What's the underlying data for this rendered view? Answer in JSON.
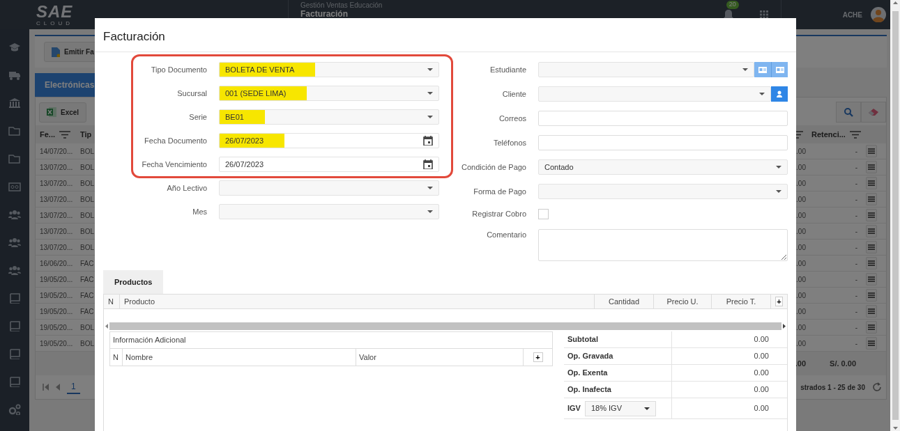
{
  "app_header": {
    "logo": "SAE",
    "logo_tagline": "CLOUD",
    "module": "Gestión Ventas Educación",
    "page": "Facturación",
    "notification_count": "20",
    "user": "ACHE"
  },
  "background": {
    "toolbar_button": "Emitir Fa",
    "tabs": [
      {
        "label": "Electrónicas",
        "selected": true
      }
    ],
    "export_button": "Excel",
    "columns_left": [
      "Fe...",
      "Tip"
    ],
    "columns_right": [
      "Retenci..."
    ],
    "rows": [
      {
        "date": "14/07/20...",
        "type": "BOL",
        "amount": ".00",
        "retention": "-"
      },
      {
        "date": "13/07/20...",
        "type": "BOL",
        "amount": ".00",
        "retention": "-"
      },
      {
        "date": "13/07/20...",
        "type": "BOL",
        "amount": ".00",
        "retention": "-"
      },
      {
        "date": "13/07/20...",
        "type": "BOL",
        "amount": ".00",
        "retention": "-"
      },
      {
        "date": "13/07/20...",
        "type": "BOL",
        "amount": ".00",
        "retention": "-"
      },
      {
        "date": "13/07/20...",
        "type": "BOL",
        "amount": ".00",
        "retention": "-"
      },
      {
        "date": "13/07/20...",
        "type": "BOL",
        "amount": ".00",
        "retention": "-"
      },
      {
        "date": "16/06/20...",
        "type": "FAC",
        "amount": ".00",
        "retention": "-"
      },
      {
        "date": "19/05/20...",
        "type": "FAC",
        "amount": ".00",
        "retention": "-"
      },
      {
        "date": "19/05/20...",
        "type": "FAC",
        "amount": ".00",
        "retention": "-"
      },
      {
        "date": "19/05/20...",
        "type": "FAC",
        "amount": ".00",
        "retention": "-"
      },
      {
        "date": "19/05/20...",
        "type": "BOL",
        "amount": ".00",
        "retention": "-"
      },
      {
        "date": "19/05/20...",
        "type": "BOL",
        "amount": ".00",
        "retention": "-"
      }
    ],
    "footer": {
      "amount": ".00",
      "retention_total": "S/. 0.00"
    },
    "pagination": {
      "page": "1",
      "summary": "strados 1 - 25 de 30"
    }
  },
  "modal": {
    "title": "Facturación",
    "annotated_fields": [
      {
        "label": "Tipo Documento",
        "kind": "select",
        "value": "BOLETA DE VENTA",
        "highlighted": true
      },
      {
        "label": "Sucursal",
        "kind": "select",
        "value": "001 (SEDE LIMA)",
        "highlighted": true
      },
      {
        "label": "Serie",
        "kind": "select",
        "value": "BE01",
        "highlighted": true
      },
      {
        "label": "Fecha Documento",
        "kind": "date",
        "value": "26/07/2023",
        "highlighted": true
      },
      {
        "label": "Fecha Vencimiento",
        "kind": "date",
        "value": "26/07/2023",
        "highlighted": false
      }
    ],
    "fields": [
      {
        "label": "Año Lectivo",
        "kind": "select"
      },
      {
        "label": "Mes",
        "kind": "select"
      }
    ],
    "right_fields": [
      {
        "label": "Estudiante",
        "kind": "select-two-buttons"
      },
      {
        "label": "Cliente",
        "kind": "select-button"
      },
      {
        "label": "Correos",
        "kind": "text"
      },
      {
        "label": "Teléfonos",
        "kind": "text"
      },
      {
        "label": "Condición de Pago",
        "kind": "select",
        "value": "Contado"
      },
      {
        "label": "Forma de Pago",
        "kind": "select"
      },
      {
        "label": "Registrar Cobro",
        "kind": "checkbox",
        "checked": false
      },
      {
        "label": "Comentario",
        "kind": "textarea"
      }
    ],
    "products": {
      "tabs": [
        {
          "label": "Productos",
          "selected": true
        }
      ],
      "columns": [
        "N",
        "Producto",
        "Cantidad",
        "Precio U.",
        "Precio T."
      ],
      "add_button": "+"
    },
    "extra_info": {
      "title": "Información Adicional",
      "columns": [
        "N",
        "Nombre",
        "Valor"
      ],
      "add_button": "+"
    },
    "totals": [
      {
        "label": "Subtotal",
        "value": "0.00"
      },
      {
        "label": "Op. Gravada",
        "value": "0.00"
      },
      {
        "label": "Op. Exenta",
        "value": "0.00"
      },
      {
        "label": "Op. Inafecta",
        "value": "0.00"
      },
      {
        "label": "IGV",
        "kind": "select",
        "selection": "18% IGV",
        "value": "0.00"
      }
    ]
  }
}
